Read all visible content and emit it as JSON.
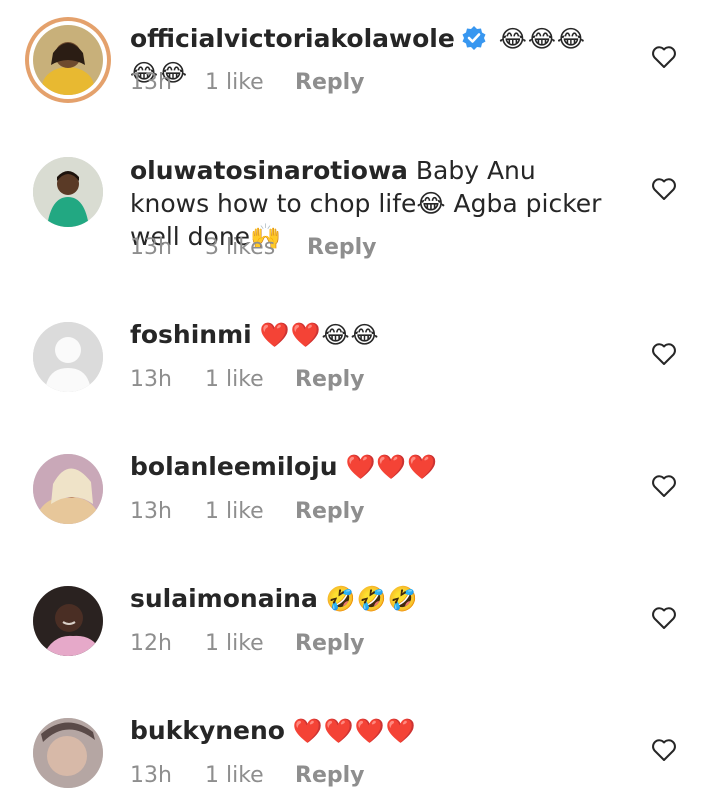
{
  "comments": [
    {
      "username": "officialvictoriakolawole",
      "verified": true,
      "text": "",
      "emoji": "😂😂😂😂😂",
      "time": "13h",
      "likes": "1 like",
      "reply": "Reply"
    },
    {
      "username": "oluwatosinarotiowa",
      "verified": false,
      "text": "Baby Anu knows how to chop life😂 Agba picker well done🙌",
      "emoji": "",
      "time": "13h",
      "likes": "3 likes",
      "reply": "Reply"
    },
    {
      "username": "foshinmi",
      "verified": false,
      "text": "",
      "emoji": "❤️❤️😂😂",
      "time": "13h",
      "likes": "1 like",
      "reply": "Reply"
    },
    {
      "username": "bolanleemiloju",
      "verified": false,
      "text": "",
      "emoji": "❤️❤️❤️",
      "time": "13h",
      "likes": "1 like",
      "reply": "Reply"
    },
    {
      "username": "sulaimonaina",
      "verified": false,
      "text": "",
      "emoji": "🤣🤣🤣",
      "time": "12h",
      "likes": "1 like",
      "reply": "Reply"
    },
    {
      "username": "bukkyneno",
      "verified": false,
      "text": "",
      "emoji": "❤️❤️❤️❤️",
      "time": "13h",
      "likes": "1 like",
      "reply": "Reply"
    }
  ],
  "icons": {
    "like": "heart-outline-icon",
    "verified": "verified-badge-icon"
  },
  "colors": {
    "text": "#262626",
    "meta": "#8e8e8e",
    "verified": "#3897f0",
    "story_ring": "#e4a16c"
  }
}
